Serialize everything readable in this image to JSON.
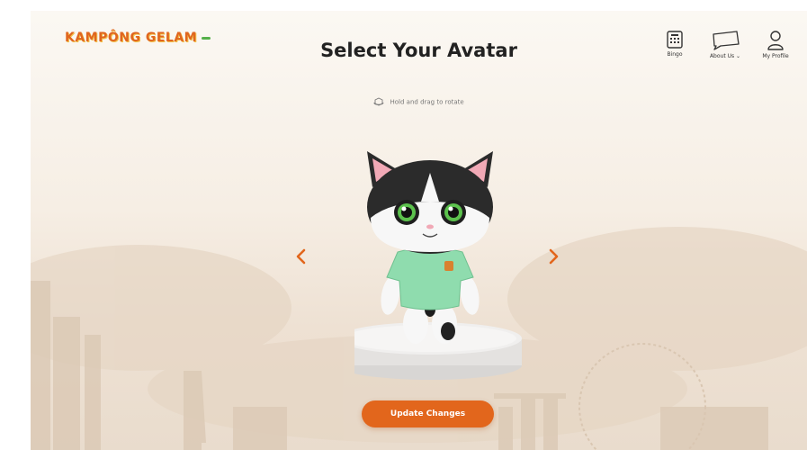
{
  "brand": {
    "logo_text": "KAMPÔNG GELAM"
  },
  "header": {
    "title": "Select Your Avatar",
    "nav": [
      {
        "label": "Bingo",
        "icon": "bingo-card-icon"
      },
      {
        "label": "About Us",
        "icon": "speech-bubble-icon",
        "dropdown_icon": "chevron-down-icon"
      },
      {
        "label": "My Profile",
        "icon": "user-profile-icon"
      }
    ]
  },
  "viewer": {
    "hint": "Hold and drag to rotate",
    "hint_icon": "rotate-3d-icon",
    "prev_icon": "chevron-left-icon",
    "next_icon": "chevron-right-icon",
    "avatar": "cat-avatar"
  },
  "actions": {
    "update_label": "Update Changes"
  },
  "colors": {
    "accent": "#e2661c",
    "shirt": "#8fdcae",
    "background": "#f6eee4"
  }
}
